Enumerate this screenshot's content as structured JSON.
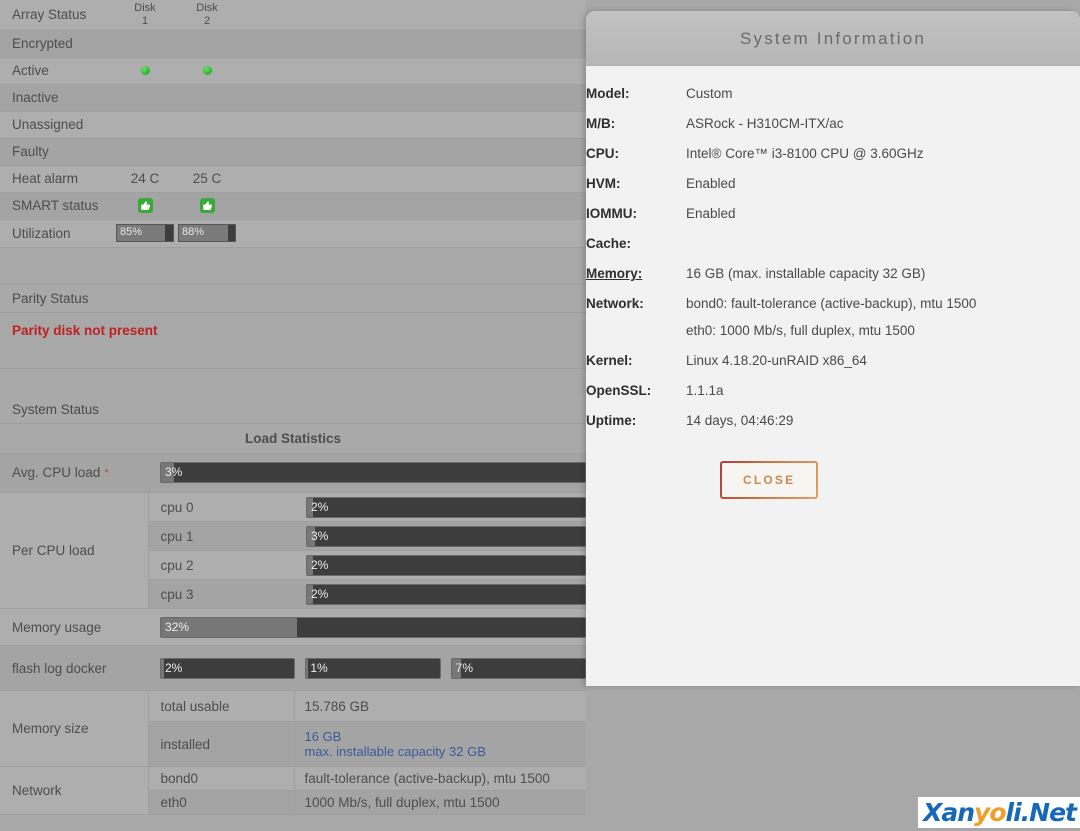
{
  "array_status": {
    "title": "Array Status",
    "columns": [
      "Disk 1",
      "Disk 2"
    ],
    "col1_line1": "Disk",
    "col1_line2": "1",
    "col2_line1": "Disk",
    "col2_line2": "2",
    "rows": [
      {
        "label": "Encrypted",
        "disk1": "",
        "disk2": "",
        "kind": "blank"
      },
      {
        "label": "Active",
        "disk1": "on",
        "disk2": "on",
        "kind": "dot"
      },
      {
        "label": "Inactive",
        "disk1": "",
        "disk2": "",
        "kind": "blank"
      },
      {
        "label": "Unassigned",
        "disk1": "",
        "disk2": "",
        "kind": "blank"
      },
      {
        "label": "Faulty",
        "disk1": "",
        "disk2": "",
        "kind": "blank"
      },
      {
        "label": "Heat alarm",
        "disk1": "24 C",
        "disk2": "25 C",
        "kind": "temp"
      },
      {
        "label": "SMART status",
        "disk1": "thumbs-up",
        "disk2": "thumbs-up",
        "kind": "smart"
      },
      {
        "label": "Utilization",
        "disk1": "85%",
        "disk2": "88%",
        "kind": "bar"
      }
    ]
  },
  "parity_status": {
    "title": "Parity Status",
    "message": "Parity disk not present"
  },
  "system_status": {
    "title": "System Status",
    "load_statistics_title": "Load Statistics",
    "avg_cpu_load": {
      "label": "Avg. CPU load",
      "asterisk": "*",
      "value": "3%",
      "percent": 3
    },
    "per_cpu_load": {
      "label": "Per CPU load",
      "cpus": [
        {
          "name": "cpu 0",
          "value": "2%",
          "percent": 2
        },
        {
          "name": "cpu 1",
          "value": "3%",
          "percent": 3
        },
        {
          "name": "cpu 2",
          "value": "2%",
          "percent": 2
        },
        {
          "name": "cpu 3",
          "value": "2%",
          "percent": 2
        }
      ]
    },
    "memory_usage": {
      "label": "Memory usage",
      "value": "32%",
      "percent": 32
    },
    "flash_log_docker": {
      "label": "flash log docker",
      "bars": [
        {
          "value": "2%",
          "percent": 2
        },
        {
          "value": "1%",
          "percent": 1
        },
        {
          "value": "7%",
          "percent": 7
        }
      ]
    },
    "memory_size": {
      "label": "Memory size",
      "rows": [
        {
          "name": "total usable",
          "value": "15.786 GB",
          "sub": ""
        },
        {
          "name": "installed",
          "value": "16 GB",
          "sub": "max. installable capacity 32 GB"
        }
      ]
    },
    "network": {
      "label": "Network",
      "rows": [
        {
          "name": "bond0",
          "value": "fault-tolerance (active-backup), mtu 1500"
        },
        {
          "name": "eth0",
          "value": "1000 Mb/s, full duplex, mtu 1500"
        }
      ]
    }
  },
  "modal": {
    "title": "System Information",
    "fields": [
      {
        "key": "Model:",
        "value": "Custom",
        "underline": false
      },
      {
        "key": "M/B:",
        "value": "ASRock - H310CM-ITX/ac",
        "underline": false
      },
      {
        "key": "CPU:",
        "value": "Intel® Core™ i3-8100 CPU @ 3.60GHz",
        "underline": false
      },
      {
        "key": "HVM:",
        "value": "Enabled",
        "underline": false
      },
      {
        "key": "IOMMU:",
        "value": "Enabled",
        "underline": false
      },
      {
        "key": "Cache:",
        "value": "",
        "underline": false
      },
      {
        "key": "Memory:",
        "value": "16 GB (max. installable capacity 32 GB)",
        "underline": true
      },
      {
        "key": "Network:",
        "value": "bond0: fault-tolerance (active-backup), mtu 1500",
        "sub": "eth0: 1000 Mb/s, full duplex, mtu 1500",
        "underline": false
      },
      {
        "key": "Kernel:",
        "value": "Linux 4.18.20-unRAID x86_64",
        "underline": false
      },
      {
        "key": "OpenSSL:",
        "value": "1.1.1a",
        "underline": false
      },
      {
        "key": "Uptime:",
        "value": "14 days, 04:46:29",
        "underline": false
      }
    ],
    "close_label": "CLOSE"
  },
  "watermark": {
    "part1": "Xan",
    "part2": "yo",
    "part3": "li.Net"
  },
  "colors": {
    "accent_link": "#3b5a99",
    "warning": "#c02020",
    "ok_green": "#3aa93a",
    "temp_green": "#3f9e3f",
    "close_border_start": "#b23b3b",
    "close_border_end": "#e0a060",
    "bar_track": "#3d3d3d",
    "bar_fill": "#777777"
  }
}
